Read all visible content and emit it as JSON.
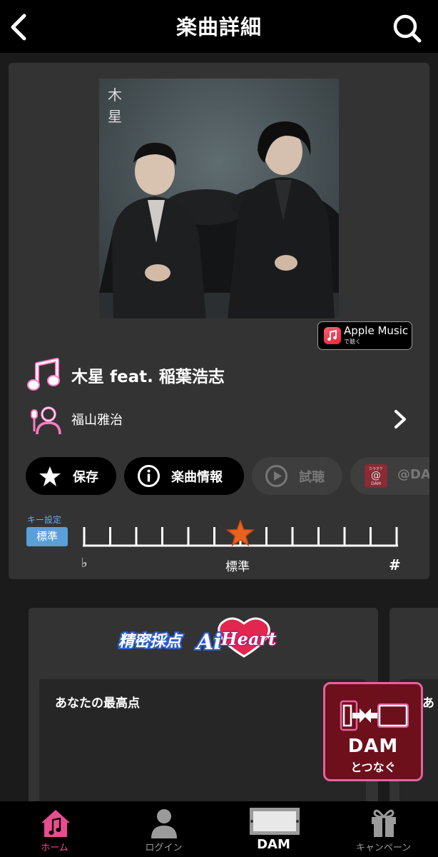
{
  "header": {
    "title": "楽曲詳細"
  },
  "song": {
    "title": "木星 feat. 稲葉浩志",
    "artist": "福山雅治",
    "jacket_text": "木星"
  },
  "apple_music": {
    "label": "Apple Music",
    "sublabel": "で聴く"
  },
  "actions": [
    {
      "label": "保存"
    },
    {
      "label": "楽曲情報"
    },
    {
      "label": "試聴"
    },
    {
      "label": "@DAM",
      "icon_text": "カラオケ\n@\nDAM"
    }
  ],
  "key": {
    "label": "キー設定",
    "current": "標準",
    "flat_symbol": "♭",
    "center_label": "標準",
    "sharp_symbol": "#",
    "steps": 13,
    "selected_index": 6
  },
  "scoring": {
    "logo_text_1": "精密採点",
    "logo_text_2": "Ai",
    "logo_text_3": "Heart",
    "best_score_label": "あなたの最高点",
    "next_card_label": "あ"
  },
  "dam_connect": {
    "title": "DAM",
    "subtitle": "とつなぐ"
  },
  "nav": [
    {
      "label": "ホーム",
      "active": true
    },
    {
      "label": "ログイン",
      "active": false
    },
    {
      "label": "DAM",
      "active": false
    },
    {
      "label": "キャンペーン",
      "active": false
    }
  ],
  "colors": {
    "accent_pink": "#e94c8f",
    "key_blue": "#5b9fd9",
    "star_orange": "#e8641e",
    "card_bg": "#333333"
  }
}
